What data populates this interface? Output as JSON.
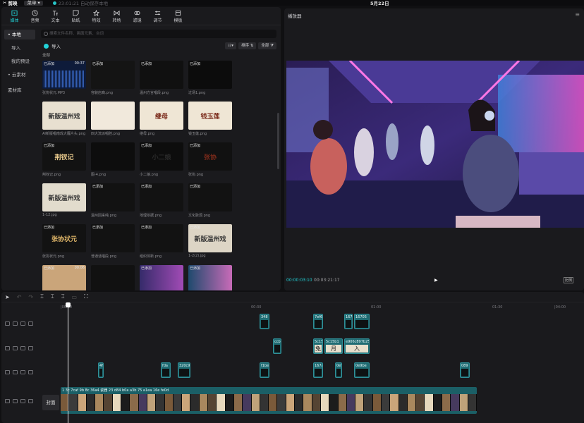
{
  "titlebar": {
    "app_name": "剪映",
    "menu_label": "菜单",
    "saved_text": "23:01:21 自动保存本地",
    "date": "5月22日"
  },
  "toolbar": [
    {
      "label": "媒体",
      "icon": "media-icon"
    },
    {
      "label": "音频",
      "icon": "audio-icon"
    },
    {
      "label": "文本",
      "icon": "text-icon"
    },
    {
      "label": "贴纸",
      "icon": "sticker-icon"
    },
    {
      "label": "特效",
      "icon": "effects-icon"
    },
    {
      "label": "转场",
      "icon": "transition-icon"
    },
    {
      "label": "滤镜",
      "icon": "filter-icon"
    },
    {
      "label": "调节",
      "icon": "adjust-icon"
    },
    {
      "label": "模板",
      "icon": "template-icon"
    }
  ],
  "sidebar": [
    {
      "label": "• 本地"
    },
    {
      "label": "导入"
    },
    {
      "label": "我的预设"
    },
    {
      "label": "• 云素材"
    },
    {
      "label": "素材库"
    }
  ],
  "media": {
    "search_placeholder": "搜索文件名称、画面元素、台词",
    "import_label": "导入",
    "view_label": "☷▾",
    "sort_label": "排序 ⇅",
    "filter_label": "全部 ⧩",
    "all_label": "全部",
    "items": [
      {
        "name": "张协状元.MP3",
        "added": "已添加",
        "duration": "00:37"
      },
      {
        "name": "容貌店裔.png",
        "added": "已添加",
        "duration": ""
      },
      {
        "name": "温州方言唱段.png",
        "added": "已添加",
        "duration": ""
      },
      {
        "name": "过场1.png",
        "added": "已添加",
        "duration": ""
      },
      {
        "name": "AI新版唱南戏大雁片头.png",
        "added": "",
        "duration": ""
      },
      {
        "name": "四大流派唱腔.png",
        "added": "",
        "duration": ""
      },
      {
        "name": "继母.png",
        "added": "",
        "duration": ""
      },
      {
        "name": "钱玉莲.png",
        "added": "",
        "duration": ""
      },
      {
        "name": "荆钗记.png",
        "added": "已添加",
        "duration": ""
      },
      {
        "name": "图-4.png",
        "added": "",
        "duration": ""
      },
      {
        "name": "小二娘.png",
        "added": "已添加",
        "duration": ""
      },
      {
        "name": "张协.png",
        "added": "已添加",
        "duration": ""
      },
      {
        "name": "1-12.jpg",
        "added": "",
        "duration": ""
      },
      {
        "name": "温州回来纯.png",
        "added": "已添加",
        "duration": ""
      },
      {
        "name": "地理依据.png",
        "added": "已添加",
        "duration": ""
      },
      {
        "name": "文化脉源.png",
        "added": "已添加",
        "duration": ""
      },
      {
        "name": "张协状元.png",
        "added": "已添加",
        "duration": ""
      },
      {
        "name": "普通话唱段.png",
        "added": "已添加",
        "duration": ""
      },
      {
        "name": "组织体新.png",
        "added": "已添加",
        "duration": ""
      },
      {
        "name": "1-2(2).jpg",
        "added": "已添加",
        "duration": ""
      },
      {
        "name": "",
        "added": "已添加",
        "duration": "00:06"
      },
      {
        "name": "",
        "added": "",
        "duration": ""
      },
      {
        "name": "",
        "added": "已添加",
        "duration": ""
      },
      {
        "name": "",
        "added": "已添加",
        "duration": ""
      }
    ],
    "calligraphy": {
      "c4": "新版温州戏",
      "c6": "继母",
      "c7": "钱玉莲",
      "c8": "荆钗记",
      "c10": "小二娘",
      "c11": "张协",
      "c12": "新版温州戏",
      "c16": "张协状元",
      "c19": "新版温州戏"
    }
  },
  "player": {
    "title": "播放器",
    "current_time": "00:00:03:10",
    "total_time": "00:03:21:17",
    "ratio_label": "比例"
  },
  "timeline": {
    "ruler_ticks": [
      "|00:00",
      "00:30",
      "01:00",
      "01:30",
      "|04:00"
    ],
    "cover_label": "封面",
    "overlay_clips": [
      {
        "label": "348",
        "track": 0
      },
      {
        "label": "7ef6",
        "track": 0
      },
      {
        "label": "167",
        "track": 0
      },
      {
        "label": "16705",
        "track": 0
      },
      {
        "label": "ccb",
        "track": 1
      },
      {
        "label": "5c15",
        "track": 1
      },
      {
        "label": "5c15b1",
        "track": 1
      },
      {
        "label": "e906c897b25",
        "track": 1
      },
      {
        "label": "4f",
        "track": 2
      },
      {
        "label": "fda",
        "track": 2
      },
      {
        "label": "320c9",
        "track": 2
      },
      {
        "label": "f1be",
        "track": 2
      },
      {
        "label": "167a",
        "track": 2
      },
      {
        "label": "0e9",
        "track": 2
      },
      {
        "label": "0e9be",
        "track": 2
      },
      {
        "label": "089",
        "track": 2
      }
    ],
    "overlay_glyphs": {
      "g1": "兔",
      "g2": "月",
      "g3": "入"
    },
    "main_labels": "1 3c  7caf  9b  8c  36a4 瓷器  23  d84  b0a a3b  75  a1ea  16e fe0d"
  },
  "colors": {
    "accent": "#22d3d8",
    "clip": "#1f6c73",
    "panel": "#1a1a1d",
    "background": "#101012"
  }
}
